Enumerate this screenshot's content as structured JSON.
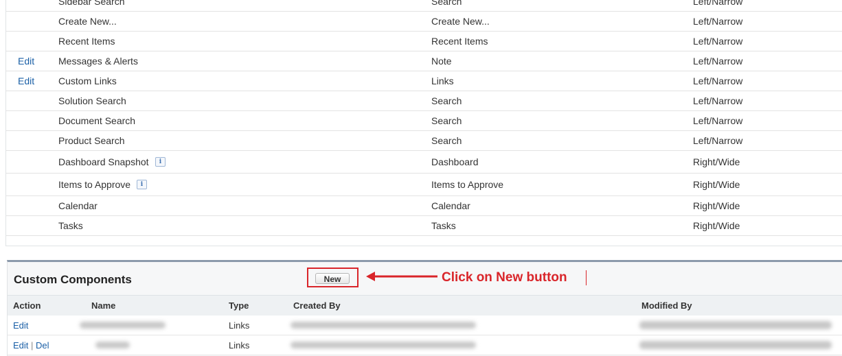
{
  "standard_components": [
    {
      "action": "",
      "name": "Sidebar Search",
      "type": "Search",
      "column": "Left/Narrow",
      "info": false
    },
    {
      "action": "",
      "name": "Create New...",
      "type": "Create New...",
      "column": "Left/Narrow",
      "info": false
    },
    {
      "action": "",
      "name": "Recent Items",
      "type": "Recent Items",
      "column": "Left/Narrow",
      "info": false
    },
    {
      "action": "Edit",
      "name": "Messages & Alerts",
      "type": "Note",
      "column": "Left/Narrow",
      "info": false
    },
    {
      "action": "Edit",
      "name": "Custom Links",
      "type": "Links",
      "column": "Left/Narrow",
      "info": false
    },
    {
      "action": "",
      "name": "Solution Search",
      "type": "Search",
      "column": "Left/Narrow",
      "info": false
    },
    {
      "action": "",
      "name": "Document Search",
      "type": "Search",
      "column": "Left/Narrow",
      "info": false
    },
    {
      "action": "",
      "name": "Product Search",
      "type": "Search",
      "column": "Left/Narrow",
      "info": false
    },
    {
      "action": "",
      "name": "Dashboard Snapshot",
      "type": "Dashboard",
      "column": "Right/Wide",
      "info": true
    },
    {
      "action": "",
      "name": "Items to Approve",
      "type": "Items to Approve",
      "column": "Right/Wide",
      "info": true
    },
    {
      "action": "",
      "name": "Calendar",
      "type": "Calendar",
      "column": "Right/Wide",
      "info": false
    },
    {
      "action": "",
      "name": "Tasks",
      "type": "Tasks",
      "column": "Right/Wide",
      "info": false
    }
  ],
  "info_icon_glyph": "i",
  "custom_components": {
    "title": "Custom Components",
    "new_button": "New",
    "annotation": "Click on New button",
    "annotation_color": "#d9252a",
    "headers": {
      "action": "Action",
      "name": "Name",
      "type": "Type",
      "created_by": "Created By",
      "modified_by": "Modified By"
    },
    "rows": [
      {
        "edit": "Edit",
        "del": "",
        "type": "Links"
      },
      {
        "edit": "Edit",
        "del": "Del",
        "type": "Links"
      }
    ]
  }
}
